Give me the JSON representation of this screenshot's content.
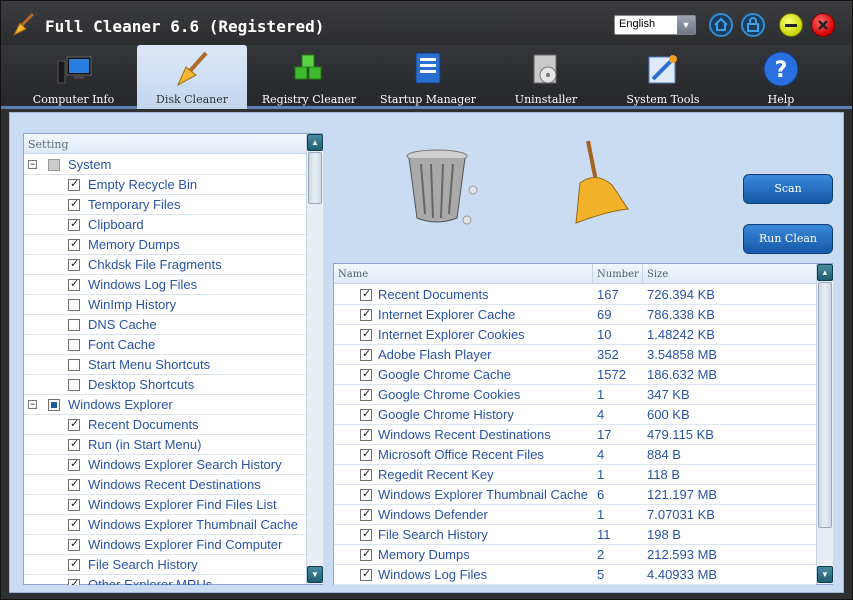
{
  "window": {
    "title": "Full Cleaner 6.6 (Registered)"
  },
  "language": {
    "selected": "English"
  },
  "tabs": [
    {
      "label": "Computer Info",
      "icon": "computer-icon"
    },
    {
      "label": "Disk Cleaner",
      "icon": "broom-icon"
    },
    {
      "label": "Registry Cleaner",
      "icon": "cubes-icon"
    },
    {
      "label": "Startup Manager",
      "icon": "startup-icon"
    },
    {
      "label": "Uninstaller",
      "icon": "uninstaller-icon"
    },
    {
      "label": "System Tools",
      "icon": "tools-icon"
    },
    {
      "label": "Help",
      "icon": "help-icon"
    }
  ],
  "active_tab": "Disk Cleaner",
  "settings": {
    "header": "Setting",
    "items": [
      {
        "label": "System",
        "type": "group",
        "state": "off"
      },
      {
        "label": "Empty Recycle Bin",
        "type": "item",
        "checked": true
      },
      {
        "label": "Temporary Files",
        "type": "item",
        "checked": true
      },
      {
        "label": "Clipboard",
        "type": "item",
        "checked": true
      },
      {
        "label": "Memory Dumps",
        "type": "item",
        "checked": true
      },
      {
        "label": "Chkdsk File Fragments",
        "type": "item",
        "checked": true
      },
      {
        "label": "Windows Log Files",
        "type": "item",
        "checked": true
      },
      {
        "label": "WinImp History",
        "type": "item",
        "checked": false
      },
      {
        "label": "DNS Cache",
        "type": "item",
        "checked": false
      },
      {
        "label": "Font Cache",
        "type": "item",
        "checked": false
      },
      {
        "label": "Start Menu Shortcuts",
        "type": "item",
        "checked": false
      },
      {
        "label": "Desktop Shortcuts",
        "type": "item",
        "checked": false
      },
      {
        "label": "Windows Explorer",
        "type": "group",
        "state": "partial"
      },
      {
        "label": "Recent Documents",
        "type": "item",
        "checked": true
      },
      {
        "label": "Run (in Start Menu)",
        "type": "item",
        "checked": true
      },
      {
        "label": "Windows Explorer Search History",
        "type": "item",
        "checked": true
      },
      {
        "label": "Windows Recent Destinations",
        "type": "item",
        "checked": true
      },
      {
        "label": "Windows Explorer Find Files List",
        "type": "item",
        "checked": true
      },
      {
        "label": "Windows Explorer Thumbnail Cache",
        "type": "item",
        "checked": true
      },
      {
        "label": "Windows Explorer Find Computer",
        "type": "item",
        "checked": true
      },
      {
        "label": "File Search History",
        "type": "item",
        "checked": true
      },
      {
        "label": "Other Explorer MRUs",
        "type": "item",
        "checked": true
      }
    ]
  },
  "buttons": {
    "scan": "Scan",
    "run_clean": "Run Clean"
  },
  "results": {
    "columns": {
      "name": "Name",
      "number": "Number",
      "size": "Size"
    },
    "rows": [
      {
        "name": "Recent Documents",
        "number": "167",
        "size": "726.394 KB"
      },
      {
        "name": "Internet Explorer Cache",
        "number": "69",
        "size": "786.338 KB"
      },
      {
        "name": "Internet Explorer Cookies",
        "number": "10",
        "size": "1.48242 KB"
      },
      {
        "name": "Adobe Flash Player",
        "number": "352",
        "size": "3.54858 MB"
      },
      {
        "name": "Google Chrome Cache",
        "number": "1572",
        "size": "186.632 MB"
      },
      {
        "name": "Google Chrome Cookies",
        "number": "1",
        "size": "347 KB"
      },
      {
        "name": "Google Chrome History",
        "number": "4",
        "size": "600 KB"
      },
      {
        "name": "Windows Recent Destinations",
        "number": "17",
        "size": "479.115 KB"
      },
      {
        "name": "Microsoft Office Recent Files",
        "number": "4",
        "size": "884 B"
      },
      {
        "name": "Regedit Recent Key",
        "number": "1",
        "size": "118 B"
      },
      {
        "name": "Windows Explorer Thumbnail Cache",
        "number": "6",
        "size": "121.197 MB"
      },
      {
        "name": "Windows Defender",
        "number": "1",
        "size": "7.07031 KB"
      },
      {
        "name": "File Search History",
        "number": "11",
        "size": "198 B"
      },
      {
        "name": "Memory Dumps",
        "number": "2",
        "size": "212.593 MB"
      },
      {
        "name": "Windows Log Files",
        "number": "5",
        "size": "4.40933 MB"
      }
    ]
  },
  "colors": {
    "accent": "#1a5ea8",
    "text": "#2953a6",
    "panel_bg": "#c9dcf2"
  }
}
